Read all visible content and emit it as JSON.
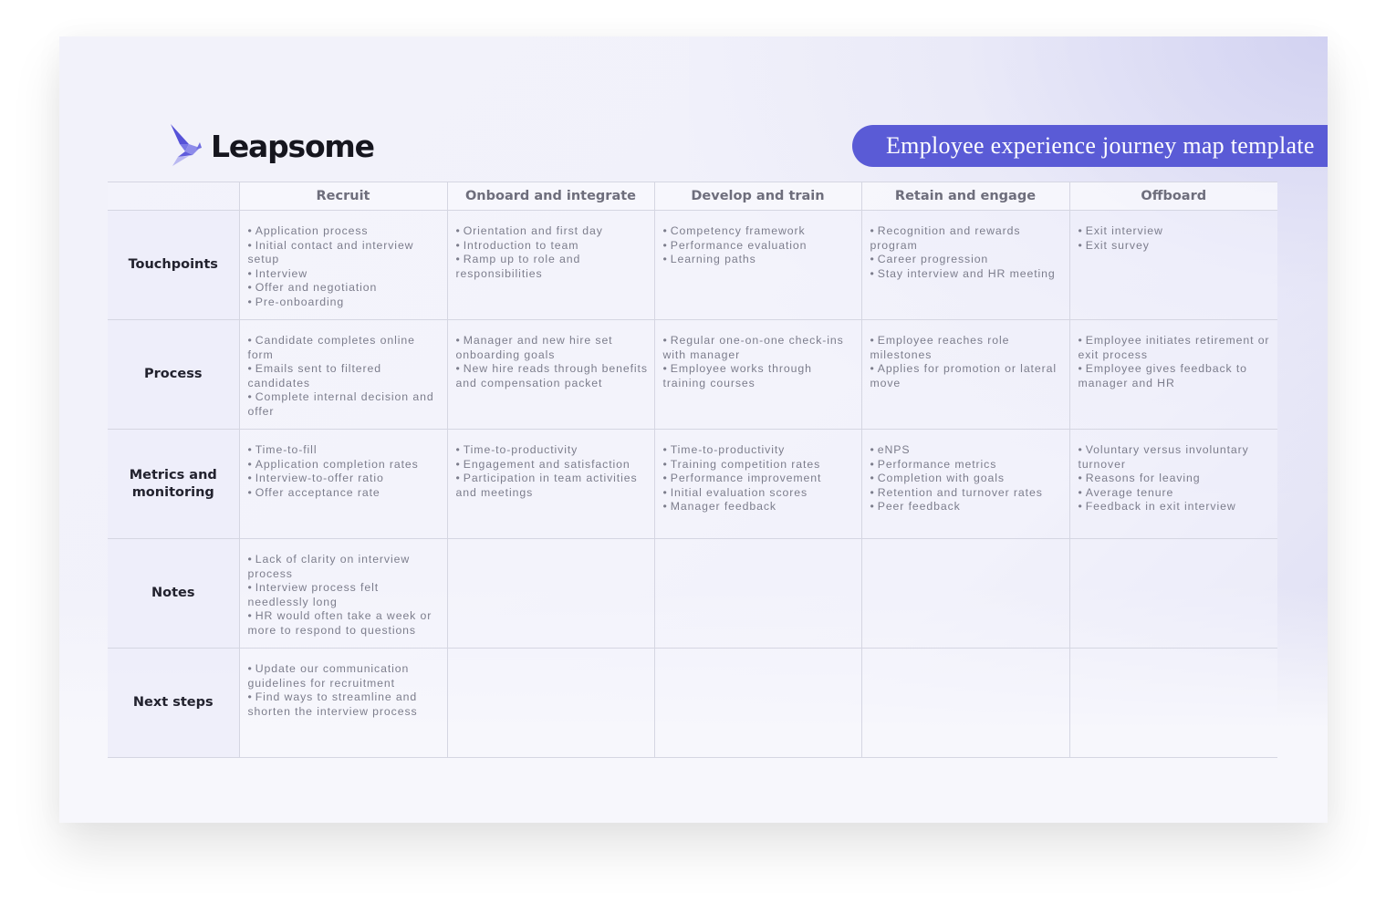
{
  "brand": {
    "name": "Leapsome",
    "logo_icon": "origami-bird-icon",
    "accent_color": "#5a5bd6"
  },
  "title": "Employee experience journey map template",
  "table": {
    "columns": [
      "Recruit",
      "Onboard and integrate",
      "Develop and train",
      "Retain and engage",
      "Offboard"
    ],
    "rows": [
      {
        "label": "Touchpoints",
        "cells": [
          [
            "Application process",
            "Initial contact and interview setup",
            "Interview",
            "Offer and negotiation",
            "Pre-onboarding"
          ],
          [
            "Orientation and first day",
            "Introduction to team",
            "Ramp up to role and responsibilities"
          ],
          [
            "Competency framework",
            "Performance evaluation",
            "Learning paths"
          ],
          [
            "Recognition and rewards program",
            "Career progression",
            "Stay interview and HR meeting"
          ],
          [
            "Exit interview",
            "Exit survey"
          ]
        ]
      },
      {
        "label": "Process",
        "cells": [
          [
            "Candidate completes online form",
            "Emails sent to filtered candidates",
            "Complete internal decision and offer"
          ],
          [
            "Manager and new hire set onboarding goals",
            "New hire reads through benefits and compensation packet"
          ],
          [
            "Regular one-on-one check-ins with manager",
            "Employee works through training courses"
          ],
          [
            "Employee reaches role milestones",
            "Applies for promotion or lateral move"
          ],
          [
            "Employee initiates retirement or exit process",
            "Employee gives feedback to manager and HR"
          ]
        ]
      },
      {
        "label": "Metrics and monitoring",
        "cells": [
          [
            "Time-to-fill",
            "Application completion rates",
            "Interview-to-offer ratio",
            "Offer acceptance rate"
          ],
          [
            "Time-to-productivity",
            "Engagement and satisfaction",
            "Participation in team activities and meetings"
          ],
          [
            "Time-to-productivity",
            "Training competition rates",
            "Performance improvement",
            "Initial evaluation scores",
            "Manager feedback"
          ],
          [
            "eNPS",
            "Performance metrics",
            "Completion with goals",
            "Retention and turnover rates",
            "Peer feedback"
          ],
          [
            "Voluntary versus involuntary turnover",
            "Reasons for leaving",
            "Average tenure",
            "Feedback in exit interview"
          ]
        ]
      },
      {
        "label": "Notes",
        "cells": [
          [
            "Lack of clarity on interview process",
            "Interview process felt needlessly long",
            "HR would often take a week or more to respond to questions"
          ],
          [],
          [],
          [],
          []
        ]
      },
      {
        "label": "Next steps",
        "cells": [
          [
            "Update our communication guidelines for recruitment",
            "Find ways to streamline and shorten the interview process"
          ],
          [],
          [],
          [],
          []
        ]
      }
    ]
  }
}
